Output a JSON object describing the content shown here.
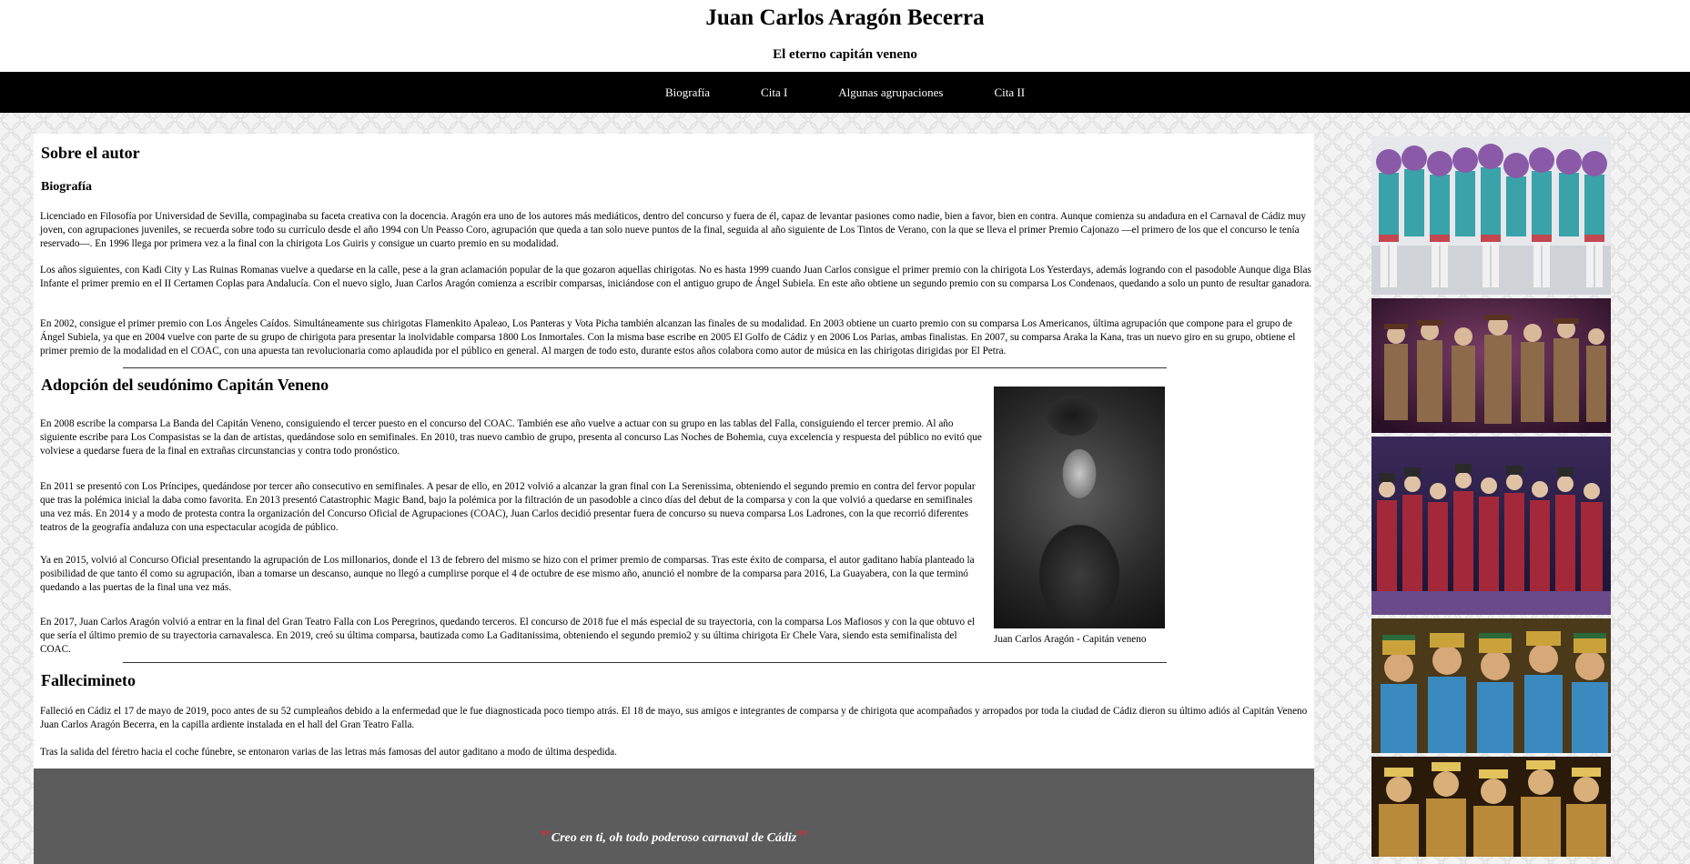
{
  "header": {
    "title": "Juan Carlos Aragón Becerra",
    "subtitle": "El eterno capitán veneno"
  },
  "nav": {
    "items": [
      "Biografía",
      "Cita I",
      "Algunas agrupaciones",
      "Cita II"
    ]
  },
  "main": {
    "section_title": "Sobre el autor",
    "bio_heading": "Biografía",
    "bio_paragraphs": [
      "Licenciado en Filosofía por Universidad de Sevilla, compaginaba su faceta creativa con la docencia. Aragón era uno de los autores más mediáticos, dentro del concurso y fuera de él, capaz de levantar pasiones como nadie, bien a favor, bien en contra. Aunque comienza su andadura en el Carnaval de Cádiz muy joven, con agrupaciones juveniles, se recuerda sobre todo su currículo desde el año 1994 con Un Peasso Coro, agrupación que queda a tan solo nueve puntos de la final, seguida al año siguiente de Los Tintos de Verano, con la que se lleva el primer Premio Cajonazo —el primero de los que el concurso le tenía reservado—. En 1996 llega por primera vez a la final con la chirigota Los Guiris y consigue un cuarto premio en su modalidad.",
      "Los años siguientes, con Kadi City y Las Ruinas Romanas vuelve a quedarse en la calle, pese a la gran aclamación popular de la que gozaron aquellas chirigotas. No es hasta 1999 cuando Juan Carlos consigue el primer premio con la chirigota Los Yesterdays, además logrando con el pasodoble Aunque diga Blas Infante el primer premio en el II Certamen Coplas para Andalucía. Con el nuevo siglo, Juan Carlos Aragón comienza a escribir comparsas, iniciándose con el antiguo grupo de Ángel Subiela. En este año obtiene un segundo premio con su comparsa Los Condenaos, quedando a solo un punto de resultar ganadora.",
      "En 2002, consigue el primer premio con Los Ángeles Caídos. Simultáneamente sus chirigotas Flamenkito Apaleao, Los Panteras y Vota Picha también alcanzan las finales de su modalidad. En 2003 obtiene un cuarto premio con su comparsa Los Americanos, última agrupación que compone para el grupo de Ángel Subiela, ya que en 2004 vuelve con parte de su grupo de chirigota para presentar la inolvidable comparsa 1800 Los Inmortales. Con la misma base escribe en 2005 El Golfo de Cádiz y en 2006 Los Parias, ambas finalistas. En 2007, su comparsa Araka la Kana, tras un nuevo giro en su grupo, obtiene el primer premio de la modalidad en el COAC, con una apuesta tan revolucionaria como aplaudida por el público en general. Al margen de todo esto, durante estos años colabora como autor de música en las chirigotas dirigidas por El Petra."
    ],
    "alias_heading": "Adopción del seudónimo Capitán Veneno",
    "alias_paragraphs": [
      "En 2008 escribe la comparsa La Banda del Capitán Veneno, consiguiendo el tercer puesto en el concurso del COAC. También ese año vuelve a actuar con su grupo en las tablas del Falla, consiguiendo el tercer premio. Al año siguiente escribe para Los Compasistas se la dan de artistas, quedándose solo en semifinales. En 2010, tras nuevo cambio de grupo, presenta al concurso Las Noches de Bohemia, cuya excelencia y respuesta del público no evitó que volviese a quedarse fuera de la final en extrañas circunstancias y contra todo pronóstico.",
      "En 2011 se presentó con Los Príncipes, quedándose por tercer año consecutivo en semifinales. A pesar de ello, en 2012 volvió a alcanzar la gran final con La Serenissima, obteniendo el segundo premio en contra del fervor popular que tras la polémica inicial la daba como favorita. En 2013 presentó Catastrophic Magic Band, bajo la polémica por la filtración de un pasodoble a cinco días del debut de la comparsa y con la que volvió a quedarse en semifinales una vez más. En 2014 y a modo de protesta contra la organización del Concurso Oficial de Agrupaciones (COAC), Juan Carlos decidió presentar fuera de concurso su nueva comparsa Los Ladrones, con la que recorrió diferentes teatros de la geografía andaluza con una espectacular acogida de público.",
      "Ya en 2015, volvió al Concurso Oficial presentando la agrupación de Los millonarios, donde el 13 de febrero del mismo se hizo con el primer premio de comparsas. Tras este éxito de comparsa, el autor gaditano había planteado la posibilidad de que tanto él como su agrupación, iban a tomarse un descanso, aunque no llegó a cumplirse porque el 4 de octubre de ese mismo año, anunció el nombre de la comparsa para 2016, La Guayabera, con la que terminó quedando a las puertas de la final una vez más.",
      "En 2017, Juan Carlos Aragón volvió a entrar en la final del Gran Teatro Falla con Los Peregrinos, quedando terceros. El concurso de 2018 fue el más especial de su trayectoria, con la comparsa Los Mafiosos y con la que obtuvo el que sería el último premio de su trayectoria carnavalesca. En 2019, creó su última comparsa, bautizada como La Gaditanissima, obteniendo el segundo premio2 y su última chirigota Er Chele Vara, siendo esta semifinalista del COAC."
    ],
    "portrait_caption": "Juan Carlos Aragón - Capitán veneno",
    "death_heading": "Fallecimineto",
    "death_paragraphs": [
      "Falleció en Cádiz el 17 de mayo de 2019, poco antes de su 52 cumpleaños debido a la enfermedad que le fue diagnosticada poco tiempo atrás. El 18 de mayo, sus amigos e integrantes de comparsa y de chirigota que acompañados y arropados por toda la ciudad de Cádiz dieron su último adiós al Capitán Veneno Juan Carlos Aragón Becerra, en la capilla ardiente instalada en el hall del Gran Teatro Falla.",
      "Tras la salida del féretro hacia el coche fúnebre, se entonaron varias de las letras más famosas del autor gaditano a modo de última despedida."
    ],
    "quote": {
      "open_mark": "\"",
      "text": "Creo en ti, oh todo poderoso carnaval de Cádiz",
      "close_mark": "\"",
      "mark_color": "#e8262b"
    }
  },
  "colors": {
    "nav_bg": "#000000",
    "quote_band_bg": "#5c5c5c",
    "content_bg": "#ffffff"
  }
}
